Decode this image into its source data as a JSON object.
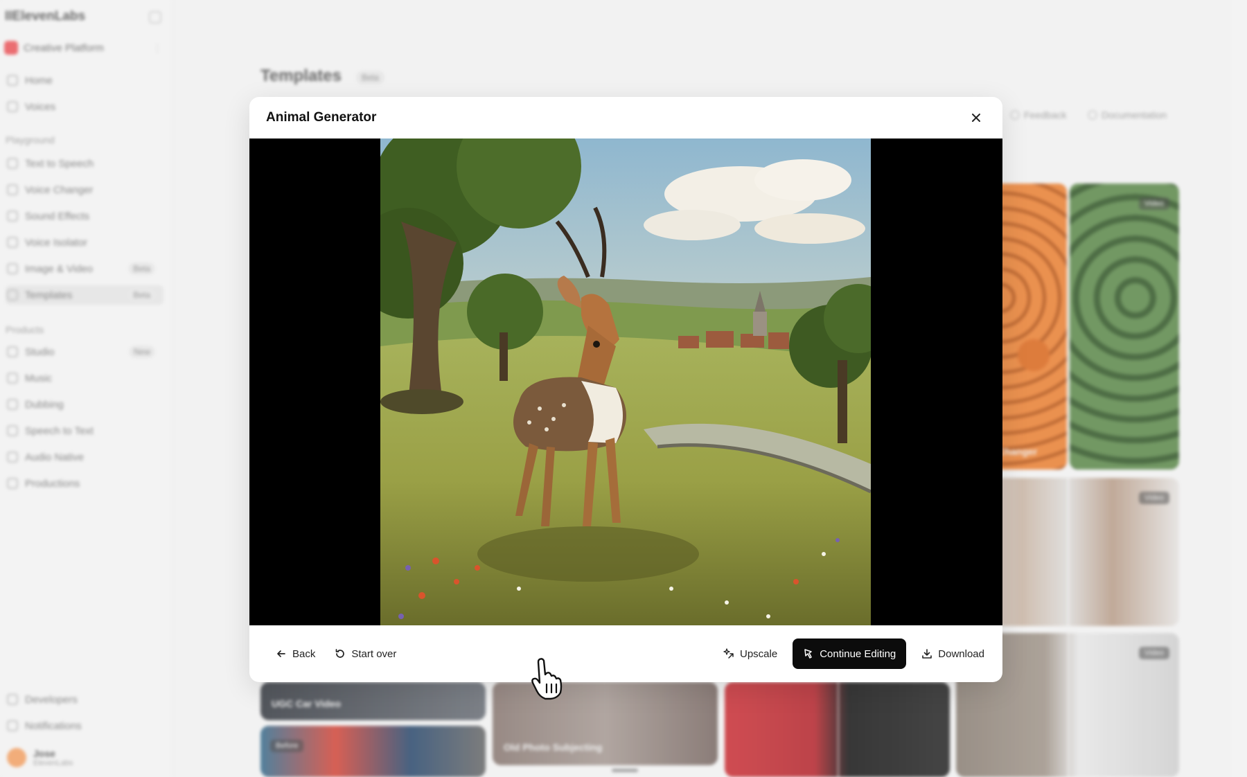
{
  "sidebar": {
    "logo": "IIElevenLabs",
    "workspace": "Creative Platform",
    "items_top": [
      {
        "label": "Home",
        "icon": "home-icon"
      },
      {
        "label": "Voices",
        "icon": "voices-icon"
      }
    ],
    "section_playground": "Playground",
    "items_playground": [
      {
        "label": "Text to Speech",
        "icon": "tts-icon",
        "badge": ""
      },
      {
        "label": "Voice Changer",
        "icon": "voice-changer-icon",
        "badge": ""
      },
      {
        "label": "Sound Effects",
        "icon": "sound-effects-icon",
        "badge": ""
      },
      {
        "label": "Voice Isolator",
        "icon": "voice-isolator-icon",
        "badge": ""
      },
      {
        "label": "Image & Video",
        "icon": "image-video-icon",
        "badge": "Beta"
      },
      {
        "label": "Templates",
        "icon": "templates-icon",
        "badge": "Beta"
      }
    ],
    "section_products": "Products",
    "items_products": [
      {
        "label": "Studio",
        "icon": "studio-icon",
        "badge": "New"
      },
      {
        "label": "Music",
        "icon": "music-icon",
        "badge": ""
      },
      {
        "label": "Dubbing",
        "icon": "dubbing-icon",
        "badge": ""
      },
      {
        "label": "Speech to Text",
        "icon": "stt-icon",
        "badge": ""
      },
      {
        "label": "Audio Native",
        "icon": "audio-native-icon",
        "badge": ""
      },
      {
        "label": "Productions",
        "icon": "productions-icon",
        "badge": ""
      }
    ],
    "items_bottom": [
      {
        "label": "Developers",
        "icon": "developers-icon"
      },
      {
        "label": "Notifications",
        "icon": "bell-icon"
      }
    ],
    "user_name": "Jose",
    "user_sub": "ElevenLabs"
  },
  "page": {
    "title": "Templates",
    "title_badge": "Beta",
    "links": {
      "feedback": "Feedback",
      "documentation": "Documentation"
    }
  },
  "tiles": {
    "tag": "Video",
    "tag_alt": "Before",
    "car_caption": "UGC Car Video",
    "restore_caption": "Old Photo Subjecting",
    "fruit_caption": "Image Changer"
  },
  "modal": {
    "title": "Animal Generator",
    "actions": {
      "back": "Back",
      "start_over": "Start over",
      "upscale": "Upscale",
      "continue_editing": "Continue Editing",
      "download": "Download"
    }
  },
  "colors": {
    "primary_button": "#0c0c0c",
    "viewer_background": "#000000"
  }
}
